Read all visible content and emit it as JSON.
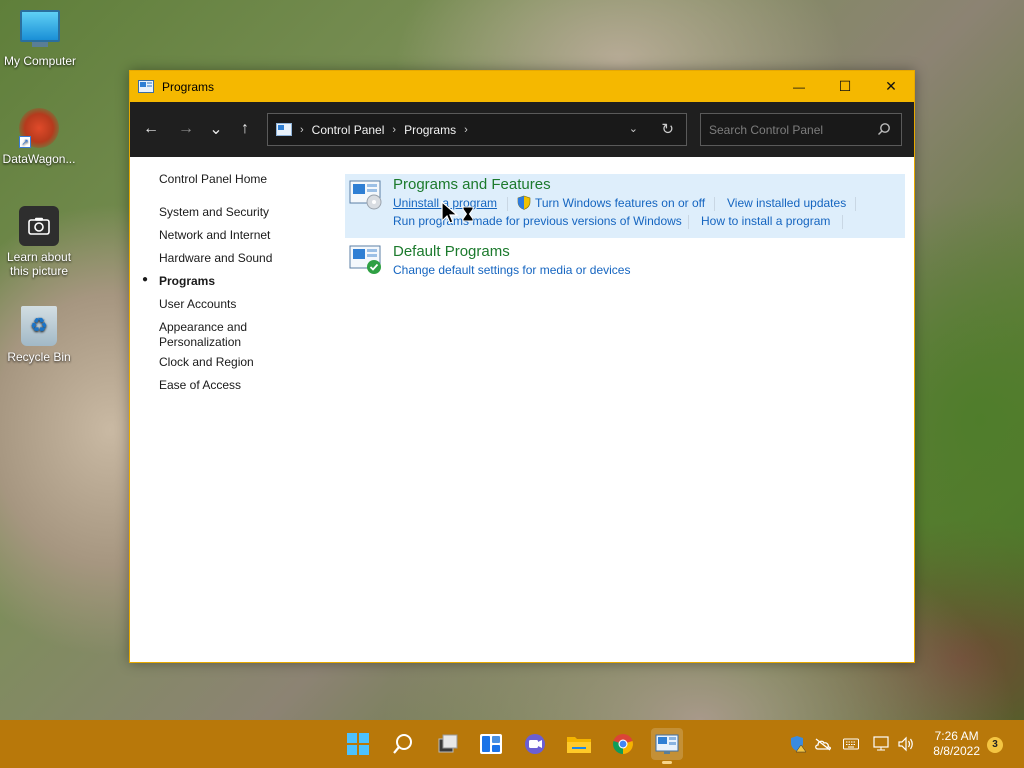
{
  "desktop": {
    "icons": [
      {
        "label": "My Computer",
        "icon": "monitor-icon"
      },
      {
        "label": "DataWagon...",
        "icon": "datawagon-icon"
      },
      {
        "label": "Learn about this picture",
        "icon": "camera-icon"
      },
      {
        "label": "Recycle Bin",
        "icon": "recycle-bin-icon"
      }
    ]
  },
  "window": {
    "title": "Programs",
    "controls": {
      "minimize": "—",
      "maximize": "☐",
      "close": "✕"
    }
  },
  "navbar": {
    "back": "←",
    "forward": "→",
    "recent": "⌄",
    "up": "↑",
    "breadcrumbs": [
      "Control Panel",
      "Programs"
    ],
    "search_placeholder": "Search Control Panel"
  },
  "leftnav": {
    "items": [
      {
        "label": "Control Panel Home"
      },
      {
        "label": "System and Security"
      },
      {
        "label": "Network and Internet"
      },
      {
        "label": "Hardware and Sound"
      },
      {
        "label": "Programs",
        "current": true
      },
      {
        "label": "User Accounts"
      },
      {
        "label": "Appearance and Personalization"
      },
      {
        "label": "Clock and Region"
      },
      {
        "label": "Ease of Access"
      }
    ]
  },
  "categories": {
    "programs_features": {
      "title": "Programs and Features",
      "links": {
        "uninstall": "Uninstall a program",
        "windows_features": "Turn Windows features on or off",
        "installed_updates": "View installed updates",
        "run_older": "Run programs made for previous versions of Windows",
        "how_install": "How to install a program"
      }
    },
    "default_programs": {
      "title": "Default Programs",
      "links": {
        "change_defaults": "Change default settings for media or devices"
      }
    }
  },
  "taskbar": {
    "apps": [
      "start-icon",
      "search-icon",
      "task-view-icon",
      "widgets-icon",
      "chat-icon",
      "file-explorer-icon",
      "chrome-icon",
      "control-panel-icon"
    ],
    "clock": {
      "time": "7:26 AM",
      "date": "8/8/2022"
    },
    "notifications": "3"
  },
  "colors": {
    "titlebar": "#f5b800",
    "taskbar": "#b8780a",
    "category_title": "#1c7a2d",
    "link": "#1565c0",
    "highlight": "#deeefb"
  }
}
